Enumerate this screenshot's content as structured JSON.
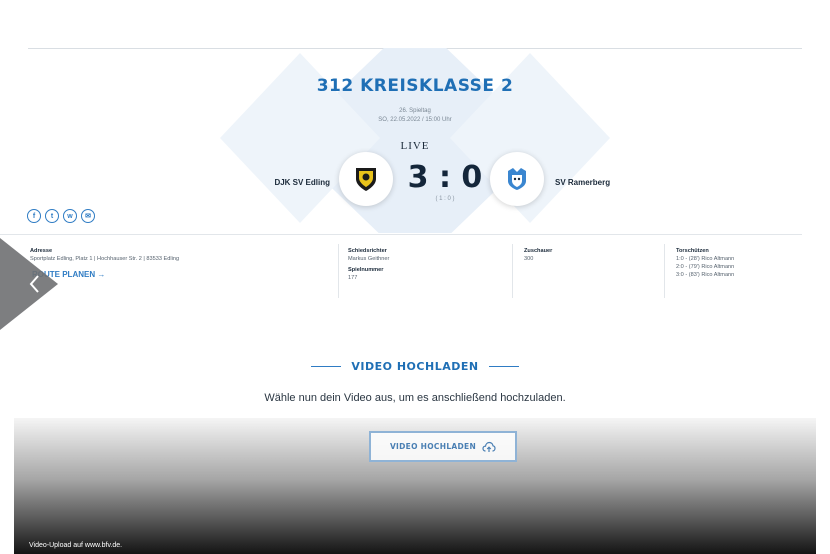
{
  "match": {
    "league_title": "312 KREISKLASSE 2",
    "matchday": "26. Spieltag",
    "datetime": "SO, 22.05.2022 / 15:00 Uhr",
    "status": "LIVE",
    "home_team": "DJK SV Edling",
    "away_team": "SV Ramerberg",
    "score": "3 : 0",
    "halftime": "( 1 : 0 )"
  },
  "social": {
    "icons": [
      "facebook-icon",
      "twitter-icon",
      "whatsapp-icon",
      "email-icon"
    ]
  },
  "info": {
    "address_label": "Adresse",
    "address_value": "Sportplatz Edling, Platz 1 | Hochhauser Str. 2 | 83533 Edling",
    "route_link": "ROUTE PLANEN →",
    "referee_label": "Schiedsrichter",
    "referee_value": "Markus Geithner",
    "game_number_label": "Spielnummer",
    "game_number_value": "177",
    "spectators_label": "Zuschauer",
    "spectators_value": "300",
    "scorers_label": "Torschützen",
    "scorers": [
      "1:0 - (28') Rico Altmann",
      "2:0 - (79') Rico Altmann",
      "3:0 - (83') Rico Altmann"
    ]
  },
  "upload": {
    "heading": "VIDEO HOCHLADEN",
    "subtitle": "Wähle nun dein Video aus, um es anschließend hochzuladen.",
    "button_label": "VIDEO HOCHLADEN"
  },
  "caption": "Video-Upload auf www.bfv.de.",
  "colors": {
    "accent_blue": "#1f6fb5",
    "link_blue": "#2f7cc4",
    "hero_diamond": "#e6eef8"
  }
}
